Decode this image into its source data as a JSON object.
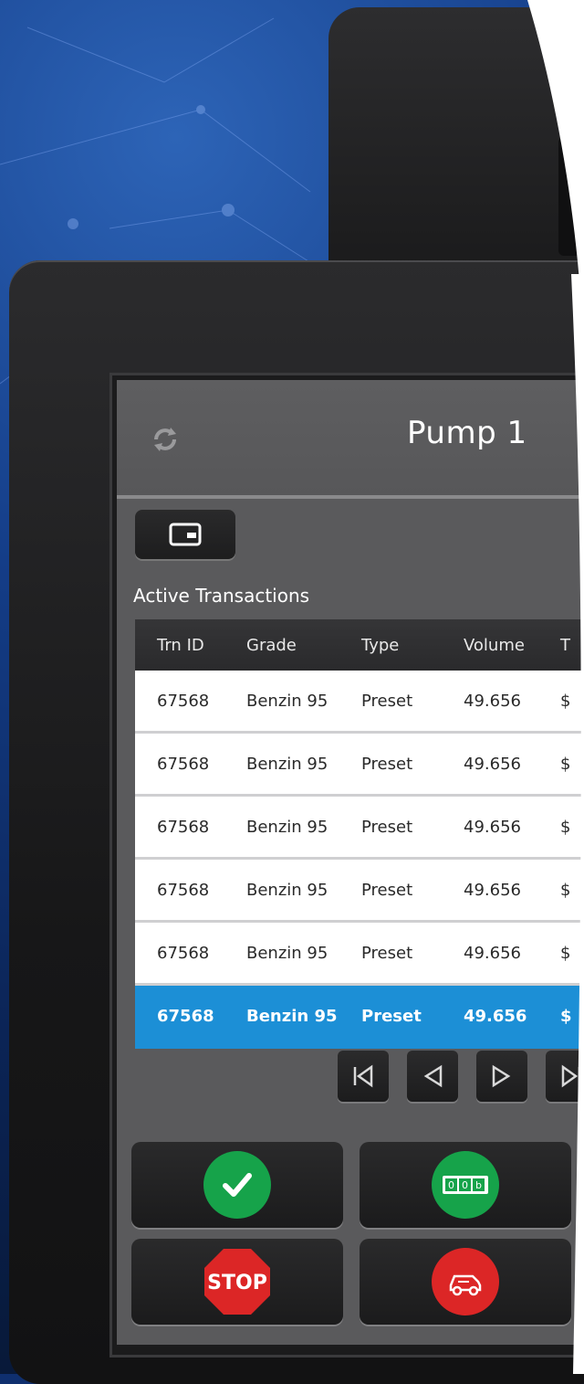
{
  "header": {
    "title": "Pump 1"
  },
  "section": {
    "title": "Active Transactions"
  },
  "table": {
    "columns": [
      "Trn ID",
      "Grade",
      "Type",
      "Volume",
      "T"
    ],
    "rows": [
      {
        "id": "67568",
        "grade": "Benzin 95",
        "type": "Preset",
        "volume": "49.656",
        "total": "$"
      },
      {
        "id": "67568",
        "grade": "Benzin 95",
        "type": "Preset",
        "volume": "49.656",
        "total": "$"
      },
      {
        "id": "67568",
        "grade": "Benzin 95",
        "type": "Preset",
        "volume": "49.656",
        "total": "$"
      },
      {
        "id": "67568",
        "grade": "Benzin 95",
        "type": "Preset",
        "volume": "49.656",
        "total": "$"
      },
      {
        "id": "67568",
        "grade": "Benzin 95",
        "type": "Preset",
        "volume": "49.656",
        "total": "$"
      },
      {
        "id": "67568",
        "grade": "Benzin 95",
        "type": "Preset",
        "volume": "49.656",
        "total": "$"
      }
    ],
    "selected_row": 5
  },
  "actions": {
    "stop_label": "STOP",
    "counter_digits": "00b"
  },
  "icons": {
    "refresh": "refresh-icon",
    "wallet": "wallet-icon",
    "first": "first-page-icon",
    "prev": "prev-page-icon",
    "next": "next-page-icon",
    "last": "last-page-icon",
    "confirm": "check-icon",
    "counter": "counter-icon",
    "stop": "stop-icon",
    "vehicle": "vehicle-icon"
  },
  "colors": {
    "selected_row": "#1c8fd6",
    "confirm": "#16a34a",
    "stop": "#dc2626"
  }
}
